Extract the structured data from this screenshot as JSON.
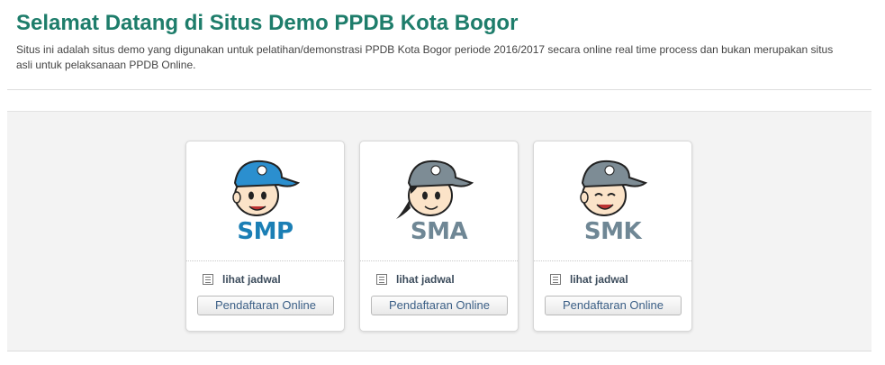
{
  "header": {
    "title": "Selamat Datang di Situs Demo PPDB Kota Bogor",
    "description": "Situs ini adalah situs demo yang digunakan untuk pelatihan/demonstrasi PPDB Kota Bogor periode 2016/2017 secara online real time process dan bukan merupakan situs asli untuk pelaksanaan PPDB Online."
  },
  "cards": [
    {
      "level": "SMP",
      "level_color": "#1b7fb5",
      "cap_color": "#2b8fcf",
      "schedule_label": "lihat jadwal",
      "button_label": "Pendaftaran Online",
      "icon": "schedule-icon"
    },
    {
      "level": "SMA",
      "level_color": "#6f8795",
      "cap_color": "#7d8c95",
      "schedule_label": "lihat jadwal",
      "button_label": "Pendaftaran Online",
      "icon": "schedule-icon"
    },
    {
      "level": "SMK",
      "level_color": "#6f8795",
      "cap_color": "#7d8c95",
      "schedule_label": "lihat jadwal",
      "button_label": "Pendaftaran Online",
      "icon": "schedule-icon"
    }
  ]
}
